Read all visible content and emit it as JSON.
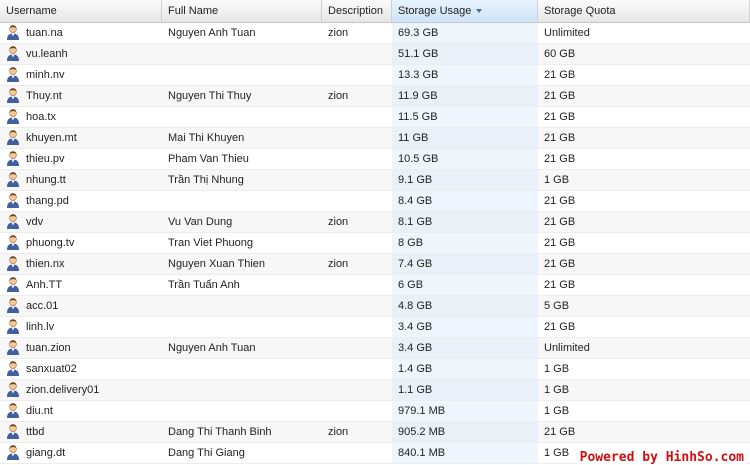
{
  "columns": [
    {
      "label": "Username"
    },
    {
      "label": "Full Name"
    },
    {
      "label": "Description"
    },
    {
      "label": "Storage Usage"
    },
    {
      "label": "Storage Quota"
    }
  ],
  "sorted_column": "Storage Usage",
  "rows": [
    {
      "username": "tuan.na",
      "full_name": "Nguyen Anh Tuan",
      "description": "zion",
      "usage": "69.3 GB",
      "quota": "Unlimited"
    },
    {
      "username": "vu.leanh",
      "full_name": "",
      "description": "",
      "usage": "51.1 GB",
      "quota": "60 GB"
    },
    {
      "username": "minh.nv",
      "full_name": "",
      "description": "",
      "usage": "13.3 GB",
      "quota": "21 GB"
    },
    {
      "username": "Thuy.nt",
      "full_name": "Nguyen Thi Thuy",
      "description": "zion",
      "usage": "11.9 GB",
      "quota": "21 GB"
    },
    {
      "username": "hoa.tx",
      "full_name": "",
      "description": "",
      "usage": "11.5 GB",
      "quota": "21 GB"
    },
    {
      "username": "khuyen.mt",
      "full_name": "Mai Thi Khuyen",
      "description": "",
      "usage": "11 GB",
      "quota": "21 GB"
    },
    {
      "username": "thieu.pv",
      "full_name": "Pham Van Thieu",
      "description": "",
      "usage": "10.5 GB",
      "quota": "21 GB"
    },
    {
      "username": "nhung.tt",
      "full_name": "Trần Thị Nhung",
      "description": "",
      "usage": "9.1 GB",
      "quota": "1 GB"
    },
    {
      "username": "thang.pd",
      "full_name": "",
      "description": "",
      "usage": "8.4 GB",
      "quota": "21 GB"
    },
    {
      "username": "vdv",
      "full_name": "Vu Van Dung",
      "description": "zion",
      "usage": "8.1 GB",
      "quota": "21 GB"
    },
    {
      "username": "phuong.tv",
      "full_name": "Tran Viet Phuong",
      "description": "",
      "usage": "8 GB",
      "quota": "21 GB"
    },
    {
      "username": "thien.nx",
      "full_name": "Nguyen Xuan Thien",
      "description": "zion",
      "usage": "7.4 GB",
      "quota": "21 GB"
    },
    {
      "username": "Anh.TT",
      "full_name": "Trần Tuấn Anh",
      "description": "",
      "usage": "6 GB",
      "quota": "21 GB"
    },
    {
      "username": "acc.01",
      "full_name": "",
      "description": "",
      "usage": "4.8 GB",
      "quota": "5 GB"
    },
    {
      "username": "linh.lv",
      "full_name": "",
      "description": "",
      "usage": "3.4 GB",
      "quota": "21 GB"
    },
    {
      "username": "tuan.zion",
      "full_name": "Nguyen Anh Tuan",
      "description": "",
      "usage": "3.4 GB",
      "quota": "Unlimited"
    },
    {
      "username": "sanxuat02",
      "full_name": "",
      "description": "",
      "usage": "1.4 GB",
      "quota": "1 GB"
    },
    {
      "username": "zion.delivery01",
      "full_name": "",
      "description": "",
      "usage": "1.1 GB",
      "quota": "1 GB"
    },
    {
      "username": "diu.nt",
      "full_name": "",
      "description": "",
      "usage": "979.1 MB",
      "quota": "1 GB"
    },
    {
      "username": "ttbd",
      "full_name": "Dang Thi Thanh Binh",
      "description": "zion",
      "usage": "905.2 MB",
      "quota": "21 GB"
    },
    {
      "username": "giang.dt",
      "full_name": "Dang Thi Giang",
      "description": "",
      "usage": "840.1 MB",
      "quota": "1 GB"
    }
  ],
  "row_icon": "user-icon",
  "watermark": "Powered by HinhSo.com",
  "colors": {
    "header_sorted": "#cfe4f9",
    "watermark": "#d01010"
  }
}
